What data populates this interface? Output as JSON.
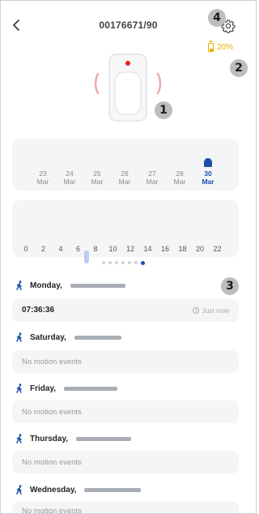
{
  "header": {
    "title": "00176671/90",
    "back_glyph": "<"
  },
  "battery": {
    "level_text": "20%",
    "color": "#e8b400"
  },
  "annotations": {
    "badge1": "1",
    "badge2": "2",
    "badge3": "3",
    "badge4": "4"
  },
  "dates": [
    {
      "day": "23",
      "month": "Mar",
      "active": false
    },
    {
      "day": "24",
      "month": "Mar",
      "active": false
    },
    {
      "day": "25",
      "month": "Mar",
      "active": false
    },
    {
      "day": "26",
      "month": "Mar",
      "active": false
    },
    {
      "day": "27",
      "month": "Mar",
      "active": false
    },
    {
      "day": "28",
      "month": "Mar",
      "active": false
    },
    {
      "day": "30",
      "month": "Mar",
      "active": true
    }
  ],
  "hours": {
    "labels": [
      "0",
      "2",
      "4",
      "6",
      "8",
      "10",
      "12",
      "14",
      "16",
      "18",
      "20",
      "22"
    ],
    "activity_hour": 7
  },
  "pager": {
    "count": 7,
    "active_index": 6
  },
  "days": [
    {
      "name": "Monday,",
      "events": [
        {
          "time": "07:36:36",
          "ago": "Just now"
        }
      ]
    },
    {
      "name": "Saturday,",
      "empty_text": "No motion events"
    },
    {
      "name": "Friday,",
      "empty_text": "No motion events"
    },
    {
      "name": "Thursday,",
      "empty_text": "No motion events"
    },
    {
      "name": "Wednesday,",
      "empty_text": "No motion events"
    }
  ],
  "colors": {
    "accent": "#1b4fa8",
    "card_bg": "#f4f5f7",
    "badge_bg": "#bdbdbd",
    "motion_red": "#e02020"
  },
  "icons": {
    "back": "chevron-left-icon",
    "settings": "gear-icon",
    "battery": "battery-icon",
    "walk": "walking-person-icon",
    "clock": "clock-icon"
  }
}
